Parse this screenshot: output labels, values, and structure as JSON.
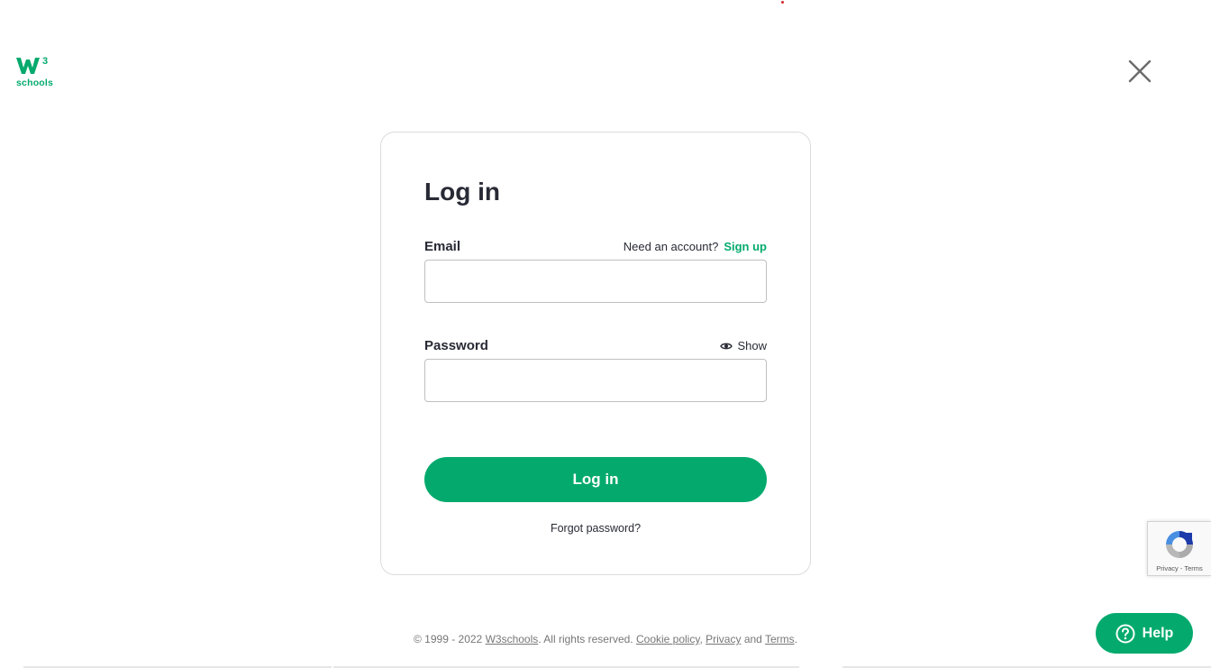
{
  "brand": {
    "logo_superscript": "3",
    "logo_text": "schools",
    "accent_color": "#04AA6D"
  },
  "form": {
    "title": "Log in",
    "email_label": "Email",
    "need_account": "Need an account?",
    "signup_label": "Sign up",
    "email_value": "",
    "password_label": "Password",
    "show_label": "Show",
    "password_value": "",
    "submit_label": "Log in",
    "forgot_label": "Forgot password?"
  },
  "footer": {
    "copyright": "© 1999 - 2022 ",
    "brand_link": "W3schools",
    "rights": ". All rights reserved. ",
    "cookie_link": "Cookie policy",
    "comma": ", ",
    "privacy_link": "Privacy",
    "and": " and ",
    "terms_link": "Terms",
    "period": "."
  },
  "recaptcha": {
    "privacy": "Privacy",
    "separator": " - ",
    "terms": "Terms"
  },
  "help": {
    "label": "Help"
  },
  "icons": {
    "close": "close-icon",
    "eye": "eye-icon",
    "help": "question-circle-icon",
    "recaptcha": "recaptcha-logo-icon"
  }
}
